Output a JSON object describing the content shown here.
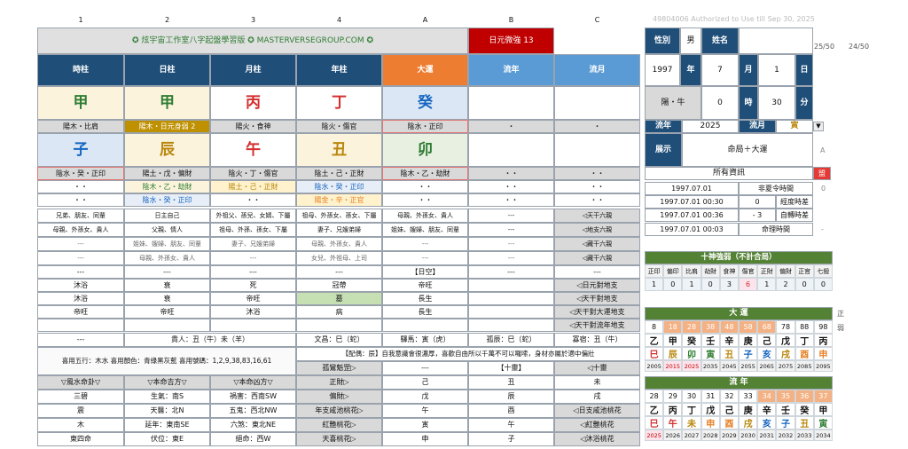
{
  "header": {
    "col_labels": [
      "1",
      "2",
      "3",
      "4",
      "A",
      "B",
      "C"
    ],
    "watermark": "49804006    Authorized to Use till Sep 30, 2025",
    "page_a": "25/50",
    "page_b": "24/50"
  },
  "banner": {
    "title": "✪ 炫宇宙工作室八字起盤學習版 ✪ MASTERVERSEGROUP.COM ✪",
    "daymaster": "日元微強 13"
  },
  "pillar_headers": [
    "時柱",
    "日柱",
    "月柱",
    "年柱",
    "大運",
    "流年",
    "流月"
  ],
  "stems": [
    {
      "char": "甲",
      "color": "#2e7d32"
    },
    {
      "char": "甲",
      "color": "#2e7d32"
    },
    {
      "char": "丙",
      "color": "#d32f2f"
    },
    {
      "char": "丁",
      "color": "#d32f2f"
    },
    {
      "char": "癸",
      "color": "#1565c0"
    }
  ],
  "stem_info": [
    "陽木・比肩",
    "陽木・日元身弱 2",
    "陽火・食神",
    "陰火・傷官",
    "陰水・正印",
    "・",
    "・"
  ],
  "branches": [
    {
      "char": "子",
      "color": "#1565c0"
    },
    {
      "char": "辰",
      "color": "#b8860b"
    },
    {
      "char": "午",
      "color": "#d32f2f"
    },
    {
      "char": "丑",
      "color": "#b8860b"
    },
    {
      "char": "卯",
      "color": "#2e7d32"
    }
  ],
  "branch_info": [
    "陰水・癸・正印",
    "陽土・戊・偏財",
    "陰火・丁・傷官",
    "陰土・己・正財",
    "陰木・乙・劫財",
    "・・",
    "・・"
  ],
  "hidden1": [
    "・・",
    "陰木・乙・劫財",
    "陽土・己・正財",
    "陰水・癸・正印",
    "・・",
    "・・",
    "・・"
  ],
  "hidden2": [
    "・・",
    "陰水・癸・正印",
    "・・",
    "陽金・辛・正官",
    "・・",
    "・・",
    "・・"
  ],
  "kin1": [
    "兄弟、朋友、同輩",
    "日主自己",
    "外祖父、孫兒、女婿、下屬",
    "祖母、外孫女、孫女、下屬",
    "母親、外孫女、貴人",
    "---",
    "◁天干六親"
  ],
  "kin2": [
    "母親、外孫女、貴人",
    "父親、情人",
    "祖母、外孫、孫女、下屬",
    "妻子、兄嫂弟婦",
    "姐妹、嫂婦、朋友、同輩",
    "---",
    "◁地支六親"
  ],
  "kin3": [
    "---",
    "姐妹、嫂婦、朋友、同輩",
    "妻子、兄嫂弟婦",
    "母親、外孫女、貴人",
    "---",
    "---",
    "◁藏干六親"
  ],
  "kin4": [
    "---",
    "母親、外孫女、貴人",
    "---",
    "女兒、外祖母、上司",
    "---",
    "---",
    "◁藏干六親"
  ],
  "void_row": [
    "---",
    "---",
    "---",
    "---",
    "【日空】",
    "---",
    "---"
  ],
  "stage1": [
    "沐浴",
    "衰",
    "死",
    "冠帶",
    "帝旺",
    "",
    "◁日元對地支"
  ],
  "stage2": [
    "沐浴",
    "衰",
    "帝旺",
    "墓",
    "長生",
    "",
    "◁天干對地支"
  ],
  "stage3": [
    "帝旺",
    "帝旺",
    "沐浴",
    "病",
    "長生",
    "",
    "◁天干對大運地支"
  ],
  "stage4_label": "◁天干對流年地支",
  "shensha": [
    "---",
    "貴人：丑（牛）未（羊）",
    "文昌：巳（蛇）",
    "驛馬：寅（虎）",
    "孤辰：巳（蛇）",
    "寡宿：丑（牛）"
  ],
  "favor": {
    "text": "喜用五行：木水  喜用顏色：青綠黑灰藍  喜用號碼：1,2,9,38,83,16,61",
    "peijian": "【配偶：辰】自我意識會很濃厚，喜歡自由所以千萬不可以囉嗦，身材亦屬於適中偏壯",
    "row2": [
      "孤鸞魁罡▷",
      "---",
      "【十靈】",
      "◁十靈"
    ]
  },
  "feng": {
    "headers": [
      "▽風水命卦▽",
      "▽本命吉方▽",
      "▽本命凶方▽",
      "正財▷",
      "己",
      "丑",
      "未"
    ],
    "rows": [
      [
        "三碧",
        "生氣：南S",
        "禍害：西南SW",
        "偏財▷",
        "戊",
        "辰",
        "戌"
      ],
      [
        "震",
        "天醫：北N",
        "五鬼：西北NW",
        "年支咸池桃花▷",
        "午",
        "酉",
        "◁日支咸池桃花"
      ],
      [
        "木",
        "延年：東南SE",
        "六煞：東北NE",
        "紅艷桃花▷",
        "寅",
        "午",
        "◁紅艷桃花"
      ],
      [
        "東四命",
        "伏位：東E",
        "絕命：西W",
        "天喜桃花▷",
        "申",
        "子",
        "◁沐浴桃花"
      ]
    ]
  },
  "info": {
    "gender_label": "性別",
    "gender": "男",
    "name_label": "姓名",
    "name": "",
    "year": "1997",
    "year_label": "年",
    "month": "7",
    "month_label": "月",
    "day": "1",
    "day_label": "日",
    "sign": "陽・牛",
    "hour_val": "0",
    "hour_label": "時",
    "min_val": "30",
    "min_label": "分",
    "flow_year_label": "流年",
    "flow_year": "2025",
    "flow_month_label": "流月",
    "flow_month": "寅",
    "show_label": "展示",
    "show_top": "命局＋大運",
    "show_bottom": "所有資訊",
    "badge": "盟",
    "a_mark": "A"
  },
  "times": [
    {
      "dt": "1997.07.01",
      "num": "",
      "label": "非夏令時間",
      "side": "0"
    },
    {
      "dt": "1997.07.01 00:30",
      "num": "0",
      "label": "經度時差",
      "side": ""
    },
    {
      "dt": "1997.07.01 00:36",
      "num": "- 3",
      "label": "自轉時差",
      "side": ""
    },
    {
      "dt": "1997.07.01 00:03",
      "num": "",
      "label": "命理時間",
      "side": "-"
    }
  ],
  "gods": {
    "title": "十神強弱（不計合局）",
    "names": [
      "正印",
      "偏印",
      "比肩",
      "劫財",
      "食神",
      "傷官",
      "正財",
      "偏財",
      "正官",
      "七殺"
    ],
    "values": [
      "1",
      "0",
      "1",
      "0",
      "3",
      "6",
      "1",
      "2",
      "0",
      "0"
    ]
  },
  "dayun": {
    "title": "大 運",
    "ages": [
      "8",
      "18",
      "28",
      "38",
      "48",
      "58",
      "68",
      "78",
      "88",
      "98"
    ],
    "stems": [
      "乙",
      "甲",
      "癸",
      "壬",
      "辛",
      "庚",
      "己",
      "戊",
      "丁",
      "丙"
    ],
    "branches": [
      "巳",
      "辰",
      "卯",
      "寅",
      "丑",
      "子",
      "亥",
      "戌",
      "酉",
      "申"
    ],
    "years": [
      "2005",
      "2015",
      "2025",
      "2035",
      "2045",
      "2055",
      "2065",
      "2075",
      "2085",
      "2095"
    ],
    "side1": "正",
    "side2": "弱"
  },
  "liunian": {
    "title": "流 年",
    "ages": [
      "28",
      "29",
      "30",
      "31",
      "32",
      "33",
      "34",
      "35",
      "36",
      "37"
    ],
    "stems": [
      "乙",
      "丙",
      "丁",
      "戊",
      "己",
      "庚",
      "辛",
      "壬",
      "癸",
      "甲"
    ],
    "branches": [
      "巳",
      "午",
      "未",
      "申",
      "酉",
      "戌",
      "亥",
      "子",
      "丑",
      "寅"
    ],
    "years": [
      "2025",
      "2026",
      "2027",
      "2028",
      "2029",
      "2030",
      "2031",
      "2032",
      "2033",
      "2034"
    ]
  },
  "colors": {
    "navy": "#1f4e79",
    "orange": "#ed7d31",
    "lightblue": "#5b9bd5",
    "green": "#548235",
    "red": "#c00000"
  }
}
